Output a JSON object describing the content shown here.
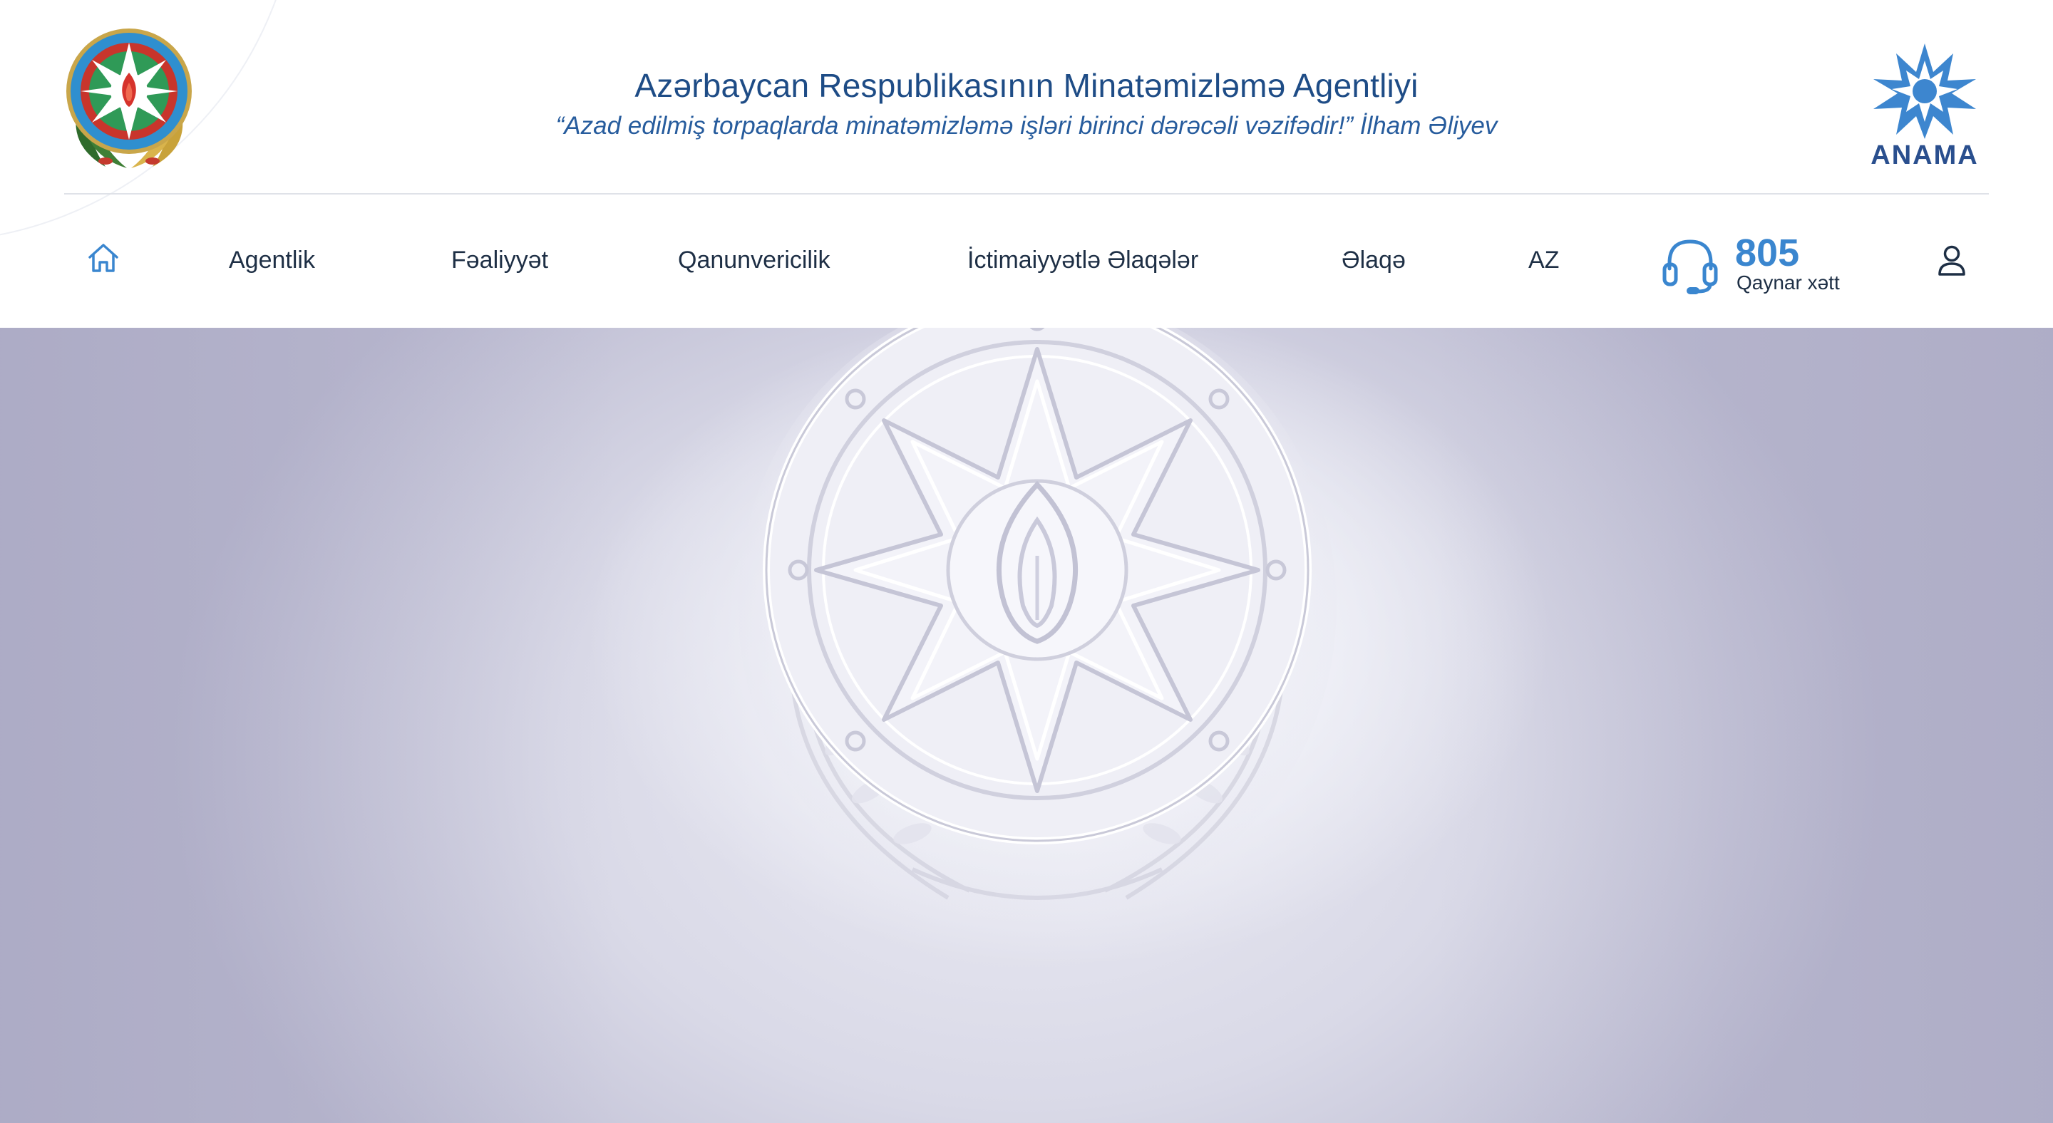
{
  "header": {
    "title": "Azərbaycan Respublikasının Minatəmizləmə Agentliyi",
    "quote": "“Azad edilmiş torpaqlarda minatəmizləmə işləri birinci dərəcəli vəzifədir!” İlham Əliyev",
    "left_emblem_icon": "azerbaijan-state-emblem-icon",
    "right_logo": {
      "icon": "anama-star-logo-icon",
      "text": "ANAMA"
    }
  },
  "nav": {
    "home_icon": "home-icon",
    "items": [
      {
        "label": "Agentlik"
      },
      {
        "label": "Fəaliyyət"
      },
      {
        "label": "Qanunvericilik"
      },
      {
        "label": "İctimaiyyətlə Əlaqələr"
      },
      {
        "label": "Əlaqə"
      }
    ],
    "language": "AZ",
    "hotline": {
      "icon": "headset-icon",
      "number": "805",
      "label": "Qaynar xətt"
    },
    "user_icon": "user-icon"
  },
  "hero": {
    "image": "embossed-state-emblem"
  },
  "colors": {
    "title": "#1e4c86",
    "accent": "#3a86cf",
    "nav_text": "#1e2f45",
    "divider": "#dfe2e8",
    "hero_bg": "#d9d9e7"
  }
}
